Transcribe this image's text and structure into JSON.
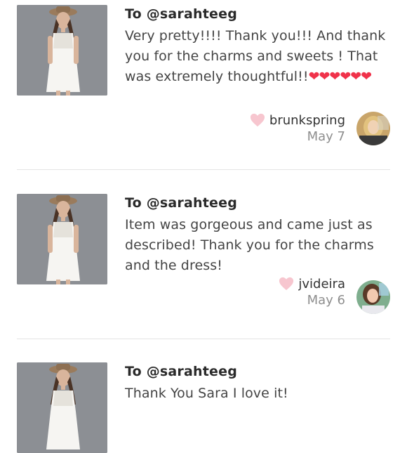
{
  "reviews": [
    {
      "to": "To @sarahteeg",
      "message": "Very pretty!!!! Thank you!!! And thank you for the charms and sweets ! That was extremely thoughtful!!",
      "hearts": "❤❤❤❤❤❤",
      "username": "brunkspring",
      "date": "May 7"
    },
    {
      "to": "To @sarahteeg",
      "message": "Item was gorgeous and came just as described! Thank you for the charms and the dress!",
      "hearts": "",
      "username": "jvideira",
      "date": "May 6"
    },
    {
      "to": "To @sarahteeg",
      "message": "Thank You Sara I love it!",
      "hearts": "",
      "username": "",
      "date": ""
    }
  ],
  "colors": {
    "heart_red": "#f0324a",
    "like_pink": "#f7c6cf",
    "divider": "#e4e4e4",
    "date_gray": "#8e8e8e"
  },
  "icons": {
    "like": "heart-icon",
    "emoji": "red-heart-emoji"
  }
}
